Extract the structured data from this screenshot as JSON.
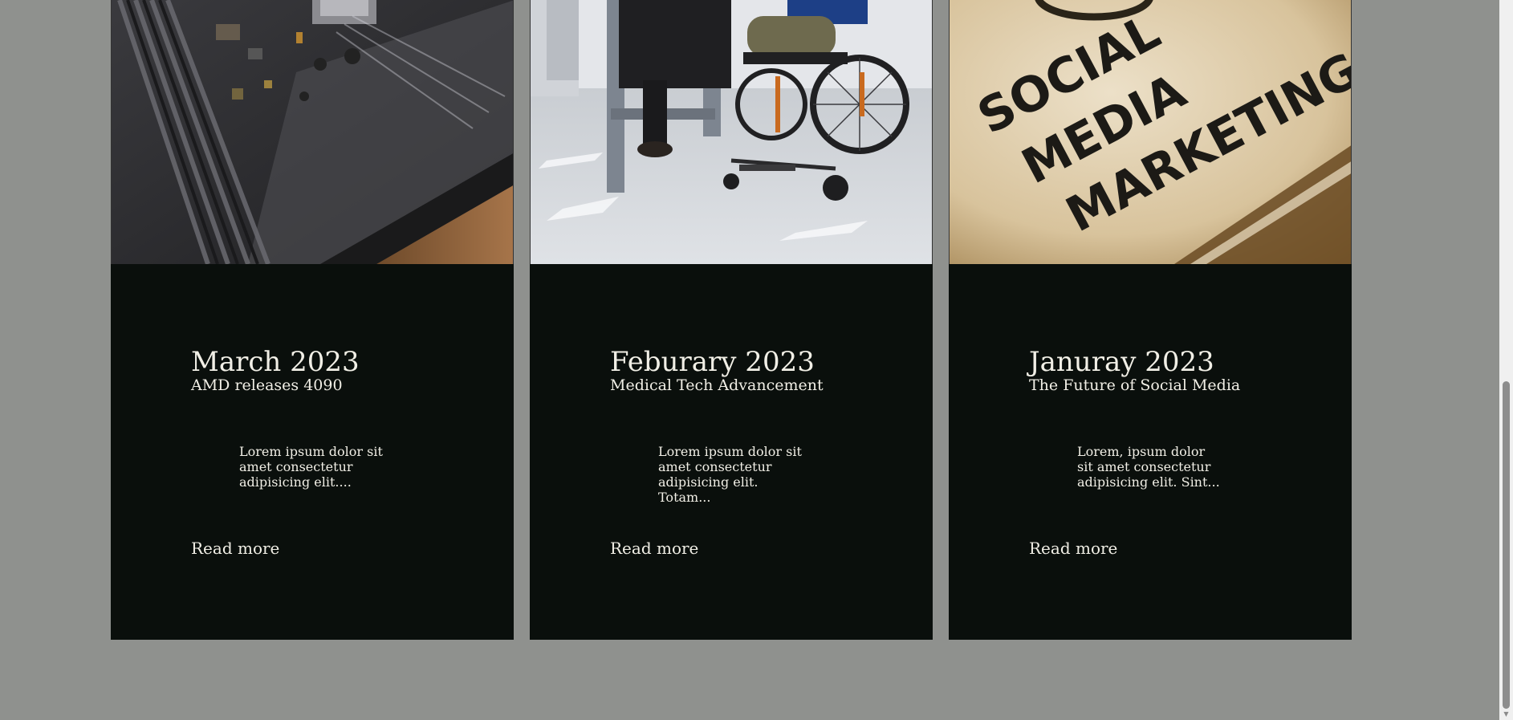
{
  "cards": [
    {
      "date": "March 2023",
      "subtitle": "AMD releases 4090",
      "excerpt": "Lorem ipsum dolor sit amet consectetur adipisicing elit....",
      "link_label": "Read more"
    },
    {
      "date": "Feburary 2023",
      "subtitle": "Medical Tech Advancement",
      "excerpt": "Lorem ipsum dolor sit amet consectetur adipisicing elit. Totam...",
      "link_label": "Read more"
    },
    {
      "date": "Januray 2023",
      "subtitle": "The Future of Social Media",
      "excerpt": "Lorem, ipsum dolor sit amet consectetur adipisicing elit. Sint...",
      "link_label": "Read more"
    }
  ],
  "images": {
    "image3_text": [
      "SOCIAL",
      "MEDIA",
      "MARKETING"
    ]
  },
  "colors": {
    "page_bg": "#8f918e",
    "card_bg": "#0a0f0c",
    "text": "#f1efe6"
  },
  "icons": {
    "scroll_down": "scroll-down-arrow-icon"
  }
}
